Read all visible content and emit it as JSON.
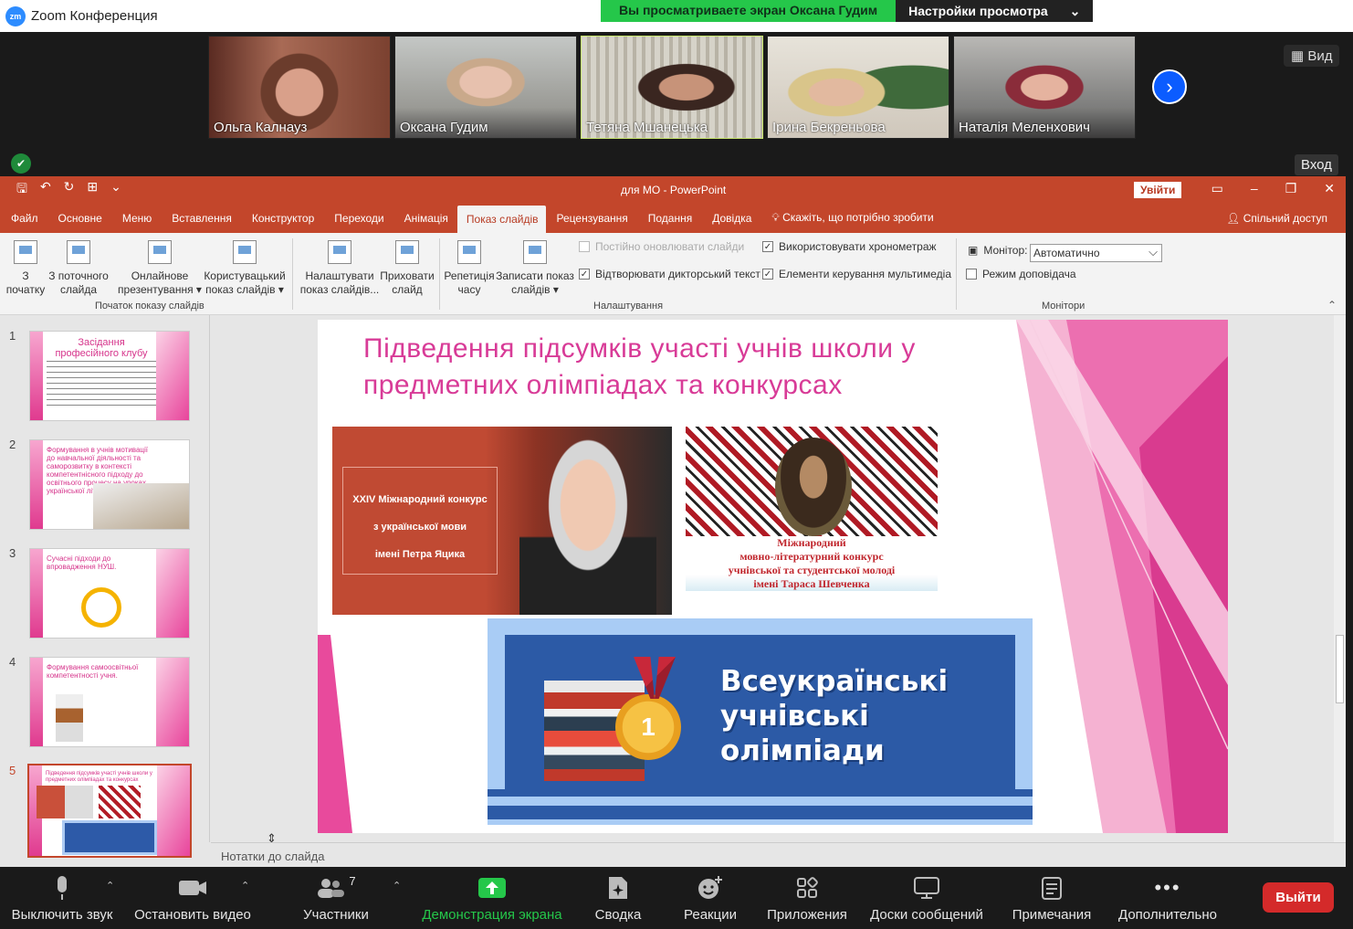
{
  "zoom": {
    "app_title": "Zoom Конференция",
    "logo_text": "zm",
    "share_banner": "Вы просматриваете экран Оксана Гудим",
    "view_settings": "Настройки просмотра",
    "view_button": "Вид",
    "enter_button": "Вход",
    "participants_tiles": [
      {
        "name": "Ольга Калнауз"
      },
      {
        "name": "Оксана Гудим"
      },
      {
        "name": "Тетяна Мшанецька"
      },
      {
        "name": "Ірина  Бекреньова"
      },
      {
        "name": "Наталія Меленхович"
      }
    ],
    "toolbar": {
      "mute": "Выключить звук",
      "video": "Остановить видео",
      "participants": "Участники",
      "participants_count": "7",
      "share": "Демонстрация экрана",
      "summary": "Сводка",
      "reactions": "Реакции",
      "apps": "Приложения",
      "whiteboards": "Доски сообщений",
      "notes": "Примечания",
      "more": "Дополнительно",
      "exit": "Выйти"
    }
  },
  "powerpoint": {
    "doc_title": "для МО  -  PowerPoint",
    "login": "Увійти",
    "menu": [
      "Файл",
      "Основне",
      "Меню",
      "Вставлення",
      "Конструктор",
      "Переходи",
      "Анімація",
      "Показ слайдів",
      "Рецензування",
      "Подання",
      "Довідка"
    ],
    "tell_me": "Скажіть, що потрібно зробити",
    "share_access": "Спільний доступ",
    "ribbon": {
      "from_start": [
        "З",
        "початку"
      ],
      "from_current": [
        "З поточного",
        "слайда"
      ],
      "online": [
        "Онлайнове",
        "презентування ▾"
      ],
      "custom": [
        "Користувацький",
        "показ слайдів ▾"
      ],
      "group_start": "Початок показу слайдів",
      "setup": [
        "Налаштувати",
        "показ слайдів..."
      ],
      "hide": [
        "Приховати",
        "слайд"
      ],
      "rehearse": [
        "Репетиція",
        "часу"
      ],
      "record": [
        "Записати показ",
        "слайдів ▾"
      ],
      "chk_update": "Постійно оновлювати слайди",
      "chk_narration": "Відтворювати дикторський текст",
      "chk_timings": "Використовувати хронометраж",
      "chk_media": "Елементи керування мультимедіа",
      "group_setup": "Налаштування",
      "monitor_label": "Монітор:",
      "monitor_value": "Автоматично",
      "presenter_view": "Режим доповідача",
      "group_monitors": "Монітори"
    },
    "thumbnails": [
      {
        "num": "1",
        "title": "Засідання професійного клубу"
      },
      {
        "num": "2",
        "title": "Формування в учнів мотивації до навчальної діяльності та саморозвитку в контексті компетентнісного підходу до освітнього процесу на уроках української літератури"
      },
      {
        "num": "3",
        "title": "Сучасні підходи до впровадження НУШ."
      },
      {
        "num": "4",
        "title": "Формування самоосвітньої компетентності учня."
      },
      {
        "num": "5",
        "title": "Підведення підсумків участі учнів школи у предметних олімпіадах та конкурсах"
      }
    ],
    "slide": {
      "title": "Підведення підсумків участі учнів школи у предметних олімпіадах та конкурсах",
      "box1": [
        "XXIV Міжнародний конкурс",
        "з української мови",
        "імені Петра Яцика"
      ],
      "box2": [
        "Міжнародний",
        "мовно-літературний конкурс",
        "учнівської та студентської молоді",
        "імені Тараса Шевченка"
      ],
      "banner": [
        "Всеукраїнські",
        "учнівські",
        "олімпіади"
      ],
      "medal_number": "1"
    },
    "notes": "Нотатки до слайда"
  },
  "colors": {
    "ppt_red": "#c3462b",
    "slide_pink": "#d83b97",
    "zoom_blue": "#0b5cff",
    "zoom_green": "#25c74a"
  }
}
